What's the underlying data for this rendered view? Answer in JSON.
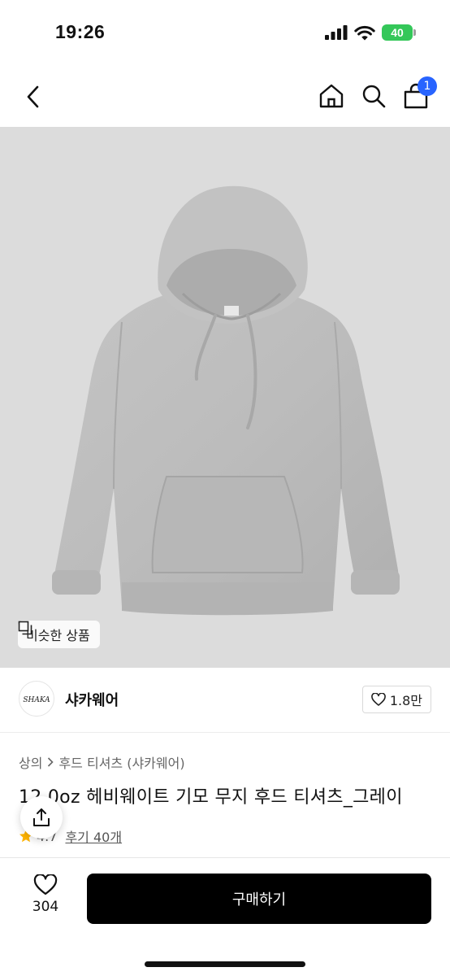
{
  "status_bar": {
    "time": "19:26",
    "battery": "40",
    "icons": [
      "signal-icon",
      "wifi-icon",
      "battery-icon"
    ]
  },
  "nav": {
    "back_icon": "chevron-left-icon",
    "home_icon": "home-icon",
    "search_icon": "search-icon",
    "cart_icon": "cart-icon",
    "cart_badge": "1"
  },
  "image": {
    "similar_label": "비슷한 상품"
  },
  "brand": {
    "name": "샤카웨어",
    "logo_text": "SHAKA",
    "likes": "1.8만"
  },
  "product": {
    "breadcrumb_category": "상의",
    "breadcrumb_sub": "후드 티셔츠 (샤카웨어)",
    "title": "12.0oz 헤비웨이트 기모 무지 후드 티셔츠_그레이",
    "rating": "4.7",
    "reviews": "후기 40개"
  },
  "bottom": {
    "wish_count": "304",
    "buy_label": "구매하기"
  },
  "colors": {
    "accent_blue": "#2864ff",
    "battery_green": "#34c759",
    "buy_button": "#000000",
    "image_bg": "#dcdcdc",
    "star": "#ffb400"
  }
}
